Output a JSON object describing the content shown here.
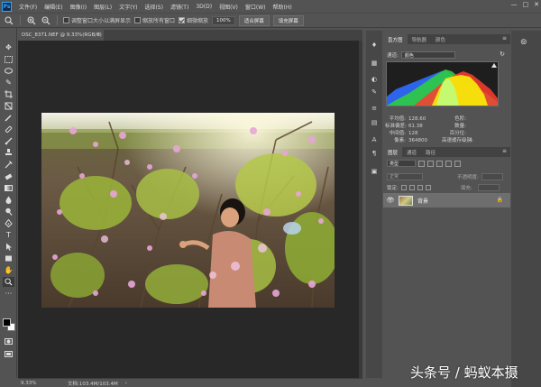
{
  "app": {
    "logo_text": "Ps"
  },
  "menu": {
    "items": [
      "文件(F)",
      "编辑(E)",
      "图像(I)",
      "图层(L)",
      "文字(Y)",
      "选择(S)",
      "滤镜(T)",
      "3D(D)",
      "视图(V)",
      "窗口(W)",
      "帮助(H)"
    ]
  },
  "window_controls": {
    "minimize": "—",
    "maximize": "□",
    "close": "✕"
  },
  "options_bar": {
    "resize_windows_label": "调整窗口大小以满屏显示",
    "zoom_all_windows_label": "缩放所有窗口",
    "scrubby_zoom_label": "细微缩放",
    "zoom_value": "100%",
    "fit_screen_label": "适合屏幕",
    "fill_screen_label": "填充屏幕"
  },
  "document": {
    "tab_title": "DSC_8371.NEF @ 9.33%(RGB/8)",
    "close": "×"
  },
  "status": {
    "zoom": "9.33%",
    "doc_info": "文档:103.4M/103.4M",
    "arrow": "›"
  },
  "histogram_panel": {
    "tabs": [
      "直方图",
      "导航器",
      "颜色"
    ],
    "channel_label": "通道:",
    "channel_value": "颜色",
    "stats_left": [
      {
        "label": "平均值:",
        "value": "128.60"
      },
      {
        "label": "标准偏差:",
        "value": "61.38"
      },
      {
        "label": "中间值:",
        "value": "128"
      },
      {
        "label": "像素:",
        "value": "364800"
      }
    ],
    "stats_right": [
      {
        "label": "色阶:",
        "value": ""
      },
      {
        "label": "数量:",
        "value": ""
      },
      {
        "label": "百分位:",
        "value": ""
      },
      {
        "label": "高速缓存级别:",
        "value": "4"
      }
    ]
  },
  "layers_panel": {
    "tabs": [
      "图层",
      "通道",
      "路径"
    ],
    "kind_label": "类型",
    "blend_mode": "正常",
    "opacity_label": "不透明度:",
    "lock_label": "锁定:",
    "fill_label": "填充:",
    "layers": [
      {
        "name": "背景"
      }
    ]
  },
  "watermark": {
    "text": "头条号 / 蚂蚁本摄"
  },
  "colors": {
    "panel_bg": "#535353",
    "canvas_bg": "#282828",
    "accent": "#31a8ff"
  }
}
